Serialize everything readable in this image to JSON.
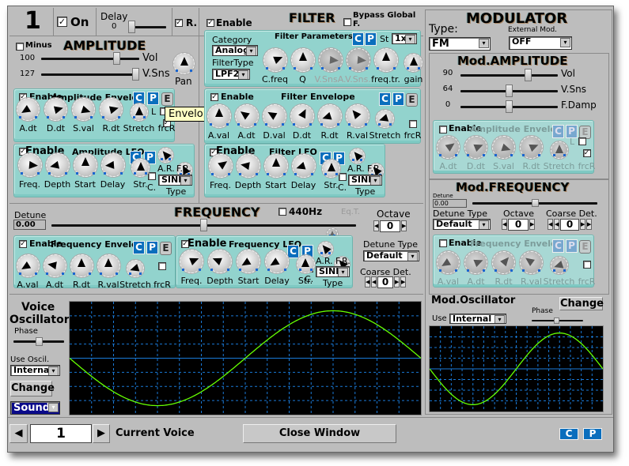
{
  "buttons": {
    "c": "C",
    "p": "P",
    "e": "E"
  },
  "header": {
    "voice_number": "1",
    "on_label": "On",
    "on_checked": true,
    "delay_label": "Delay",
    "delay_value": "0",
    "delay_level": 0.0,
    "r_label": "R.",
    "r_checked": true
  },
  "amplitude": {
    "title": "AMPLITUDE",
    "minus_label": "Minus",
    "minus_checked": false,
    "vol": {
      "value": "100",
      "label": "Vol",
      "level": 0.79
    },
    "vsns": {
      "value": "127",
      "label": "V.Sns",
      "level": 1.0
    },
    "pan": {
      "label": "Pan",
      "v": 0.5
    },
    "envelope": {
      "enable_label": "Enable",
      "enable_checked": true,
      "title": "Amplitude Envelop",
      "l_label": "L",
      "l_checked": false,
      "frcr_checked": true,
      "knobs": [
        {
          "label": "A.dt",
          "v": 0.05
        },
        {
          "label": "D.dt",
          "v": 0.78
        },
        {
          "label": "S.val",
          "v": 0.9
        },
        {
          "label": "R.dt",
          "v": 0.78
        },
        {
          "label": "Stretch",
          "v": 0.5,
          "s": 1
        },
        {
          "label": "frcR",
          "v": null
        }
      ]
    },
    "lfo": {
      "enable_label": "Enable",
      "enable_checked": true,
      "title": "Amplitude LFO",
      "ar_label": "A.R.",
      "fr_label": "F.R.",
      "ar_v": 0.35,
      "fr_v": 0.4,
      "c_label": "C.",
      "c_checked": false,
      "type_value": "SINE",
      "type_label": "Type",
      "knobs": [
        {
          "label": "Freq.",
          "v": 0.85
        },
        {
          "label": "Depth",
          "v": 0.12
        },
        {
          "label": "Start",
          "v": 0.5
        },
        {
          "label": "Delay",
          "v": 0.15
        },
        {
          "label": "Str.",
          "v": 0.5,
          "s": 1
        }
      ]
    }
  },
  "filter": {
    "title": "FILTER",
    "enable_label": "Enable",
    "enable_checked": true,
    "bypass_label": "Bypass Global F.",
    "bypass_checked": false,
    "params": {
      "title": "Filter Parameters",
      "category_label": "Category",
      "category_value": "Analog",
      "type_label": "FilterType",
      "type_value": "LPF2",
      "st_label": "St",
      "st_value": "1x",
      "knobs": [
        {
          "label": "C.freq",
          "v": 0.75
        },
        {
          "label": "Q",
          "v": 0.5
        },
        {
          "label": "V.SnsA.",
          "v": 0.85,
          "d": 1
        },
        {
          "label": "V.Sns.",
          "v": 0.85,
          "d": 1
        },
        {
          "label": "freq.tr.",
          "v": 0.5
        },
        {
          "label": "gain",
          "v": 0.5,
          "s": 1
        }
      ]
    },
    "envelope": {
      "enable_label": "Enable",
      "enable_checked": true,
      "title": "Filter Envelope",
      "frcr_checked": false,
      "knobs": [
        {
          "label": "A.val",
          "v": 0.5
        },
        {
          "label": "A.dt",
          "v": 0.3
        },
        {
          "label": "D.val",
          "v": 0.28
        },
        {
          "label": "D.dt",
          "v": 0.6
        },
        {
          "label": "R.dt",
          "v": 0.1
        },
        {
          "label": "R.val",
          "v": 0.35
        },
        {
          "label": "Stretch",
          "v": 0.1,
          "s": 1
        },
        {
          "label": "frcR",
          "v": null
        }
      ]
    },
    "lfo": {
      "enable_label": "Enable",
      "enable_checked": true,
      "title": "Filter LFO",
      "ar_label": "A.R.",
      "fr_label": "F.R.",
      "ar_v": 0.35,
      "fr_v": 0.35,
      "c_label": "C.",
      "c_checked": false,
      "type_value": "SINE",
      "type_label": "Type",
      "knobs": [
        {
          "label": "Freq.",
          "v": 0.7
        },
        {
          "label": "Depth",
          "v": 0.2
        },
        {
          "label": "Start",
          "v": 0.5
        },
        {
          "label": "Delay",
          "v": 0.1
        },
        {
          "label": "Str.",
          "v": 0.5,
          "s": 1
        }
      ]
    }
  },
  "frequency": {
    "title": "FREQUENCY",
    "detune_label": "Detune",
    "detune_value": "0.00",
    "detune_level": 0.5,
    "hz440_label": "440Hz",
    "hz440_checked": false,
    "eqt_label": "Eq.T.",
    "octave_label": "Octave",
    "octave_value": "0",
    "detune_type_label": "Detune Type",
    "detune_type_value": "Default",
    "coarse_label": "Coarse Det.",
    "coarse_value": "0",
    "envelope": {
      "enable_label": "Enable",
      "enable_checked": true,
      "title": "Frequency Envelop",
      "frcr_checked": false,
      "knobs": [
        {
          "label": "A.val",
          "v": 0.05
        },
        {
          "label": "A.dt",
          "v": 0.2
        },
        {
          "label": "R.dt",
          "v": 0.5
        },
        {
          "label": "R.val",
          "v": 0.5
        },
        {
          "label": "Stretch",
          "v": 0.1,
          "s": 1
        },
        {
          "label": "frcR",
          "v": null
        }
      ]
    },
    "lfo": {
      "enable_label": "Enable",
      "enable_checked": true,
      "title": "Frequency LFO",
      "ar_label": "A.R.",
      "fr_label": "F.R.",
      "ar_v": 0.35,
      "fr_v": 0.35,
      "c_label": "C.",
      "c_checked": false,
      "type_value": "SINE",
      "type_label": "Type",
      "knobs": [
        {
          "label": "Freq.",
          "v": 0.75
        },
        {
          "label": "Depth",
          "v": 0.25
        },
        {
          "label": "Start",
          "v": 0.05
        },
        {
          "label": "Delay",
          "v": 0.05
        },
        {
          "label": "Str.",
          "v": 0.5,
          "s": 1
        }
      ]
    }
  },
  "voice_oscillator": {
    "title_line1": "Voice",
    "title_line2": "Oscillator",
    "phase_label": "Phase",
    "phase_level": 0.5,
    "use_label": "Use Oscil.",
    "use_value": "Internal",
    "change_label": "Change",
    "view_value": "Sound"
  },
  "modulator": {
    "title": "MODULATOR",
    "type_label": "Type:",
    "type_value": "FM",
    "ext_label": "External Mod.",
    "ext_value": "OFF",
    "amplitude": {
      "title": "Mod.AMPLITUDE",
      "sliders": [
        {
          "value": "90",
          "label": "Vol",
          "level": 0.71
        },
        {
          "value": "64",
          "label": "V.Sns",
          "level": 0.5
        },
        {
          "value": "0",
          "label": "F.Damp",
          "level": 0.5
        }
      ],
      "envelope": {
        "enable_label": "Enable",
        "enable_checked": false,
        "title": "Amplitude Envelop",
        "l_label": "L",
        "l_checked": false,
        "frcr_checked": true,
        "knobs": [
          {
            "label": "A.dt",
            "v": 0.7
          },
          {
            "label": "D.dt",
            "v": 0.75
          },
          {
            "label": "S.val",
            "v": 0.9
          },
          {
            "label": "R.dt",
            "v": 0.75
          },
          {
            "label": "Stretch",
            "v": 0.5,
            "s": 1
          },
          {
            "label": "frcR",
            "v": null
          }
        ]
      }
    },
    "frequency": {
      "title": "Mod.FREQUENCY",
      "detune_label": "Detune",
      "detune_value": "0.00",
      "detune_level": 0.5,
      "detune_type_label": "Detune Type",
      "detune_type_value": "Default",
      "octave_label": "Octave",
      "octave_value": "0",
      "coarse_label": "Coarse Det.",
      "coarse_value": "0",
      "envelope": {
        "enable_label": "Enable",
        "enable_checked": false,
        "title": "Frequency Envelop",
        "frcr_checked": false,
        "knobs": [
          {
            "label": "A.val",
            "v": 0.05
          },
          {
            "label": "A.dt",
            "v": 0.75
          },
          {
            "label": "R.dt",
            "v": 0.65
          },
          {
            "label": "R.val",
            "v": 0.3
          },
          {
            "label": "Stretch",
            "v": 0.1,
            "s": 1
          },
          {
            "label": "frcR",
            "v": null
          }
        ]
      }
    },
    "oscillator": {
      "title": "Mod.Oscillator",
      "change_label": "Change",
      "use_label": "Use",
      "use_value": "Internal",
      "phase_label": "Phase",
      "phase_level": 0.5
    }
  },
  "footer": {
    "voice_value": "1",
    "current_voice_label": "Current Voice",
    "close_label": "Close Window"
  },
  "tooltip": {
    "text": "Envelope window"
  },
  "colors": {
    "panel": "#92d3cd",
    "scope_bg": "#000000",
    "scope_grid": "#1a7ad8",
    "wave": "#66ff00",
    "button": "#0a6ebd"
  }
}
